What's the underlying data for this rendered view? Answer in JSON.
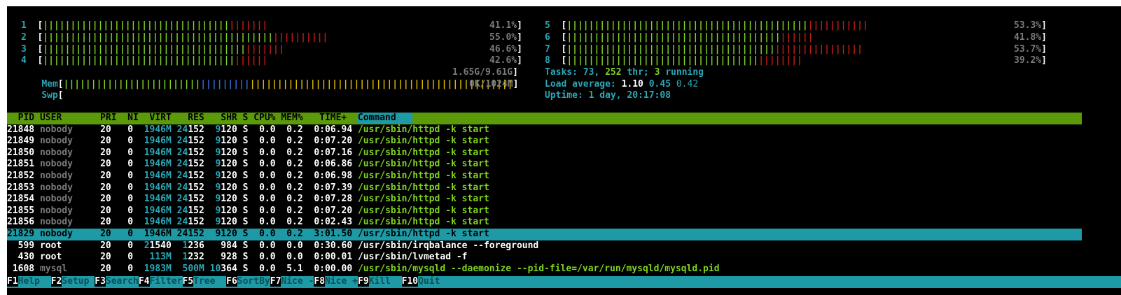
{
  "cpus_left": [
    {
      "id": "1",
      "green": "||||||||||||||||||||||||||||||||||",
      "red": "|||||||",
      "pct": "41.1%"
    },
    {
      "id": "2",
      "green": "||||||||||||||||||||||||||||||||||||||||||",
      "red": "||||||||||",
      "pct": "55.0%"
    },
    {
      "id": "3",
      "green": "|||||||||||||||||||||||||||||||||||||",
      "red": "|||||||",
      "pct": "46.6%"
    },
    {
      "id": "4",
      "green": "|||||||||||||||||||||||||||||||||||",
      "red": "||||||",
      "pct": "42.6%"
    }
  ],
  "cpus_right": [
    {
      "id": "5",
      "green": "||||||||||||||||||||||||||||||||||||||||||||",
      "red": "|||||||||||",
      "pct": "53.3%"
    },
    {
      "id": "6",
      "green": "|||||||||||||||||||||||||||||||||||||||",
      "red": "||||||",
      "pct": "41.8%"
    },
    {
      "id": "7",
      "green": "||||||||||||||||||||||||||||||||||||||",
      "red": "||||||||||||||||",
      "pct": "53.7%"
    },
    {
      "id": "8",
      "green": "|||||||||||||||||||||||||||||||||||",
      "red": "||||||||",
      "pct": "39.2%"
    }
  ],
  "mem": {
    "label": "Mem",
    "green": "|||||||||||||||||||||||||",
    "blue": "|||||||||",
    "yellow": "||||||||||||||||||||||||||||||||||||||||||||||||",
    "value": "1.65G/9.61G"
  },
  "swp": {
    "label": "Swp",
    "value": "0K/1024M"
  },
  "tasks": {
    "label": "Tasks:",
    "count": "73",
    "sep": ",",
    "thr": "252",
    "thr_label": "thr;",
    "running": "3",
    "running_label": "running"
  },
  "load": {
    "label": "Load average:",
    "l1": "1.10",
    "l5": "0.45",
    "l15": "0.42"
  },
  "uptime": {
    "label": "Uptime:",
    "value": "1 day, 20:17:08"
  },
  "columns": {
    "pid": "PID",
    "user": "USER",
    "pri": "PRI",
    "ni": "NI",
    "virt": "VIRT",
    "res": "RES",
    "shr": "SHR",
    "s": "S",
    "cpu": "CPU%",
    "mem": "MEM%",
    "time": "TIME+",
    "command": "Command"
  },
  "processes": [
    {
      "pid": "21848",
      "user": "nobody",
      "pri": "20",
      "ni": "0",
      "virt": "1946M",
      "res_a": "24",
      "res_b": "152",
      "shr_a": "9",
      "shr_b": "120",
      "s": "S",
      "cpu": "0.0",
      "mem": "0.2",
      "time": "0:06.94",
      "cmd": "/usr/sbin/httpd -k start",
      "kind": "thread"
    },
    {
      "pid": "21849",
      "user": "nobody",
      "pri": "20",
      "ni": "0",
      "virt": "1946M",
      "res_a": "24",
      "res_b": "152",
      "shr_a": "9",
      "shr_b": "120",
      "s": "S",
      "cpu": "0.0",
      "mem": "0.2",
      "time": "0:07.20",
      "cmd": "/usr/sbin/httpd -k start",
      "kind": "thread"
    },
    {
      "pid": "21850",
      "user": "nobody",
      "pri": "20",
      "ni": "0",
      "virt": "1946M",
      "res_a": "24",
      "res_b": "152",
      "shr_a": "9",
      "shr_b": "120",
      "s": "S",
      "cpu": "0.0",
      "mem": "0.2",
      "time": "0:07.16",
      "cmd": "/usr/sbin/httpd -k start",
      "kind": "thread"
    },
    {
      "pid": "21851",
      "user": "nobody",
      "pri": "20",
      "ni": "0",
      "virt": "1946M",
      "res_a": "24",
      "res_b": "152",
      "shr_a": "9",
      "shr_b": "120",
      "s": "S",
      "cpu": "0.0",
      "mem": "0.2",
      "time": "0:06.86",
      "cmd": "/usr/sbin/httpd -k start",
      "kind": "thread"
    },
    {
      "pid": "21852",
      "user": "nobody",
      "pri": "20",
      "ni": "0",
      "virt": "1946M",
      "res_a": "24",
      "res_b": "152",
      "shr_a": "9",
      "shr_b": "120",
      "s": "S",
      "cpu": "0.0",
      "mem": "0.2",
      "time": "0:06.98",
      "cmd": "/usr/sbin/httpd -k start",
      "kind": "thread"
    },
    {
      "pid": "21853",
      "user": "nobody",
      "pri": "20",
      "ni": "0",
      "virt": "1946M",
      "res_a": "24",
      "res_b": "152",
      "shr_a": "9",
      "shr_b": "120",
      "s": "S",
      "cpu": "0.0",
      "mem": "0.2",
      "time": "0:07.39",
      "cmd": "/usr/sbin/httpd -k start",
      "kind": "thread"
    },
    {
      "pid": "21854",
      "user": "nobody",
      "pri": "20",
      "ni": "0",
      "virt": "1946M",
      "res_a": "24",
      "res_b": "152",
      "shr_a": "9",
      "shr_b": "120",
      "s": "S",
      "cpu": "0.0",
      "mem": "0.2",
      "time": "0:07.28",
      "cmd": "/usr/sbin/httpd -k start",
      "kind": "thread"
    },
    {
      "pid": "21855",
      "user": "nobody",
      "pri": "20",
      "ni": "0",
      "virt": "1946M",
      "res_a": "24",
      "res_b": "152",
      "shr_a": "9",
      "shr_b": "120",
      "s": "S",
      "cpu": "0.0",
      "mem": "0.2",
      "time": "0:07.20",
      "cmd": "/usr/sbin/httpd -k start",
      "kind": "thread"
    },
    {
      "pid": "21856",
      "user": "nobody",
      "pri": "20",
      "ni": "0",
      "virt": "1946M",
      "res_a": "24",
      "res_b": "152",
      "shr_a": "9",
      "shr_b": "120",
      "s": "S",
      "cpu": "0.0",
      "mem": "0.2",
      "time": "0:02.43",
      "cmd": "/usr/sbin/httpd -k start",
      "kind": "thread"
    },
    {
      "pid": "21829",
      "user": "nobody",
      "pri": "20",
      "ni": "0",
      "virt": "1946M",
      "res_a": "24",
      "res_b": "152",
      "shr_a": "9",
      "shr_b": "120",
      "s": "S",
      "cpu": "0.0",
      "mem": "0.2",
      "time": "3:01.50",
      "cmd": "/usr/sbin/httpd -k start",
      "kind": "selected"
    },
    {
      "pid": "599",
      "user": "root",
      "pri": "20",
      "ni": "0",
      "virt": "21540",
      "virt_a": "2",
      "virt_b": "1540",
      "res_a": "1",
      "res_b": "236",
      "shr_a": "",
      "shr_b": "984",
      "s": "S",
      "cpu": "0.0",
      "mem": "0.0",
      "time": "0:30.60",
      "cmd": "/usr/sbin/irqbalance --foreground",
      "kind": "root"
    },
    {
      "pid": "430",
      "user": "root",
      "pri": "20",
      "ni": "0",
      "virt": "113M",
      "res_a": "1",
      "res_b": "232",
      "shr_a": "",
      "shr_b": "928",
      "s": "S",
      "cpu": "0.0",
      "mem": "0.0",
      "time": "0:00.01",
      "cmd": "/usr/sbin/lvmetad -f",
      "kind": "root"
    },
    {
      "pid": "1608",
      "user": "mysql",
      "pri": "20",
      "ni": "0",
      "virt": "1983M",
      "res_a": "",
      "res_b": "500M",
      "shr_a": "10",
      "shr_b": "364",
      "s": "S",
      "cpu": "0.0",
      "mem": "5.1",
      "time": "0:00.00",
      "cmd": "/usr/sbin/mysqld --daemonize --pid-file=/var/run/mysqld/mysqld.pid",
      "kind": "mysql"
    }
  ],
  "footer": [
    {
      "key": "F1",
      "label": "Help  "
    },
    {
      "key": "F2",
      "label": "Setup "
    },
    {
      "key": "F3",
      "label": "Search"
    },
    {
      "key": "F4",
      "label": "Filter"
    },
    {
      "key": "F5",
      "label": "Tree  "
    },
    {
      "key": "F6",
      "label": "SortBy"
    },
    {
      "key": "F7",
      "label": "Nice -"
    },
    {
      "key": "F8",
      "label": "Nice +"
    },
    {
      "key": "F9",
      "label": "Kill  "
    },
    {
      "key": "F10",
      "label": "Quit"
    }
  ]
}
